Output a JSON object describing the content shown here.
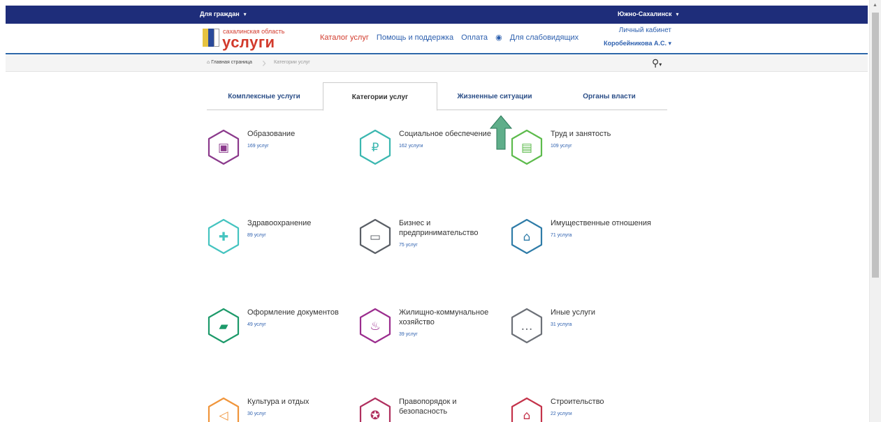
{
  "topbar": {
    "left_label": "Для граждан",
    "right_label": "Южно-Сахалинск"
  },
  "logo": {
    "small_text": "сахалинская область",
    "big_text": "услуги"
  },
  "nav": {
    "catalog": "Каталог услуг",
    "help": "Помощь и поддержка",
    "payment": "Оплата",
    "visually_impaired": "Для слабовидящих"
  },
  "account": {
    "cabinet": "Личный кабинет",
    "user": "Коробейникова А.С."
  },
  "breadcrumb": {
    "home": "Главная страница",
    "current": "Категории услуг"
  },
  "tabs": [
    {
      "label": "Комплексные услуги"
    },
    {
      "label": "Категории услуг"
    },
    {
      "label": "Жизненные ситуации"
    },
    {
      "label": "Органы власти"
    }
  ],
  "categories": [
    {
      "name": "Образование",
      "count": "169 услуг",
      "color": "#8b3a8c"
    },
    {
      "name": "Социальное обеспечение",
      "count": "162 услуги",
      "color": "#3bb7b0"
    },
    {
      "name": "Труд и занятость",
      "count": "109 услуг",
      "color": "#5dbb4c"
    },
    {
      "name": "Здравоохранение",
      "count": "89 услуг",
      "color": "#45c4c0"
    },
    {
      "name": "Бизнес и предпринимательство",
      "count": "75 услуг",
      "color": "#5a5f66"
    },
    {
      "name": "Имущественные отношения",
      "count": "71 услуга",
      "color": "#2f7ca8"
    },
    {
      "name": "Оформление документов",
      "count": "49 услуг",
      "color": "#1d9a6a"
    },
    {
      "name": "Жилищно-коммунальное хозяйство",
      "count": "39 услуг",
      "color": "#9b2d8e"
    },
    {
      "name": "Иные услуги",
      "count": "31 услуга",
      "color": "#6d7178"
    },
    {
      "name": "Культура и отдых",
      "count": "30 услуг",
      "color": "#f0953b"
    },
    {
      "name": "Правопорядок и безопасность",
      "count": "",
      "color": "#b0305f"
    },
    {
      "name": "Строительство",
      "count": "22 услуги",
      "color": "#c4334a"
    }
  ],
  "colors": {
    "topbar": "#1e2d7a",
    "accent_red": "#d23a2c",
    "link_blue": "#2c5fae",
    "arrow_green": "#5fae8a"
  }
}
